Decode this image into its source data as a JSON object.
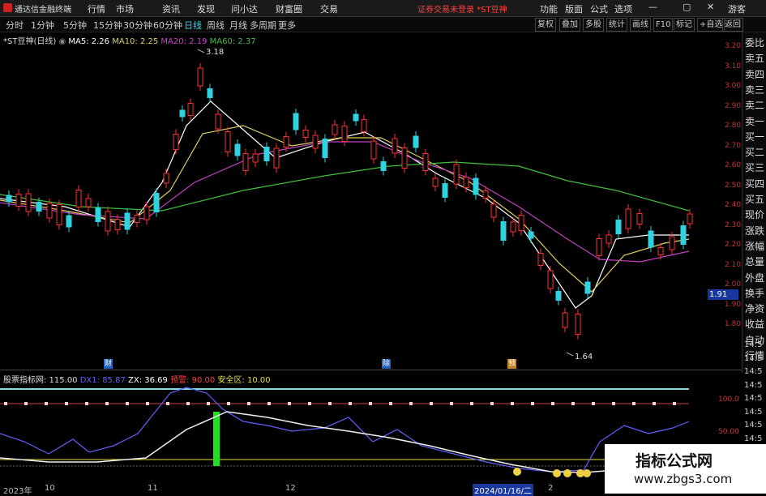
{
  "app": {
    "name": "通达信金融终端"
  },
  "menu": [
    "行情",
    "市场",
    "资讯",
    "发现",
    "问小达",
    "财富圈",
    "交易"
  ],
  "status": "证券交易未登录 *ST豆神",
  "right_menu": [
    "功能",
    "版面",
    "公式",
    "选项",
    "游客"
  ],
  "timeframes": [
    "分时",
    "1分钟",
    "5分钟",
    "15分钟",
    "30分钟",
    "60分钟",
    "日线",
    "周线",
    "月线",
    "多周期",
    "更多"
  ],
  "active_timeframe": "日线",
  "toolbar_right": [
    "复权",
    "叠加",
    "多股",
    "统计",
    "画线",
    "F10",
    "标记",
    "+自选",
    "返回"
  ],
  "legend": {
    "title": "*ST豆神(日线)",
    "ma5": "MA5: 2.26",
    "ma10": "MA10: 2.25",
    "ma20": "MA20: 2.19",
    "ma60": "MA60: 2.37"
  },
  "price_axis": [
    "3.20",
    "3.10",
    "3.00",
    "2.90",
    "2.80",
    "2.70",
    "2.60",
    "2.50",
    "2.40",
    "2.30",
    "2.20",
    "2.10",
    "2.00",
    "1.90",
    "1.80"
  ],
  "current_price": "1.91",
  "high_label": "3.18",
  "low_label": "1.64",
  "side_panel": [
    "委比",
    "卖五",
    "卖四",
    "卖三",
    "卖二",
    "卖一",
    "买一",
    "买二",
    "买三",
    "买四",
    "买五",
    "现价",
    "涨跌",
    "涨幅",
    "总量",
    "外盘",
    "换手",
    "净资",
    "收益",
    "自动",
    "行情"
  ],
  "side_times": [
    "14:5",
    "14:5",
    "14:5",
    "14:5",
    "14:5",
    "14:5",
    "14:5",
    "14:5",
    "14:5",
    "14:5",
    "14:5"
  ],
  "event_markers": [
    "财",
    "除",
    "预"
  ],
  "indicator": {
    "name": "股票指标网",
    "value": ": 115.00",
    "dx1": "DX1: 85.87",
    "zx": "ZX: 36.69",
    "alert": "预警: 90.00",
    "safe": "安全区: 10.00"
  },
  "indicator_axis": [
    "100.0",
    "50.00"
  ],
  "x_axis": [
    "2023年",
    "10",
    "11",
    "12",
    "2024/01/16/二",
    "2"
  ],
  "watermark": {
    "title": "指标公式网",
    "url": "www.zbgs3.com"
  },
  "colors": {
    "up": "#ff3030",
    "down": "#2fd3e0",
    "ma5": "#ffffff",
    "ma10": "#e0d060",
    "ma20": "#c040c0",
    "ma60": "#40c040",
    "indicator": "#6060ff"
  }
}
